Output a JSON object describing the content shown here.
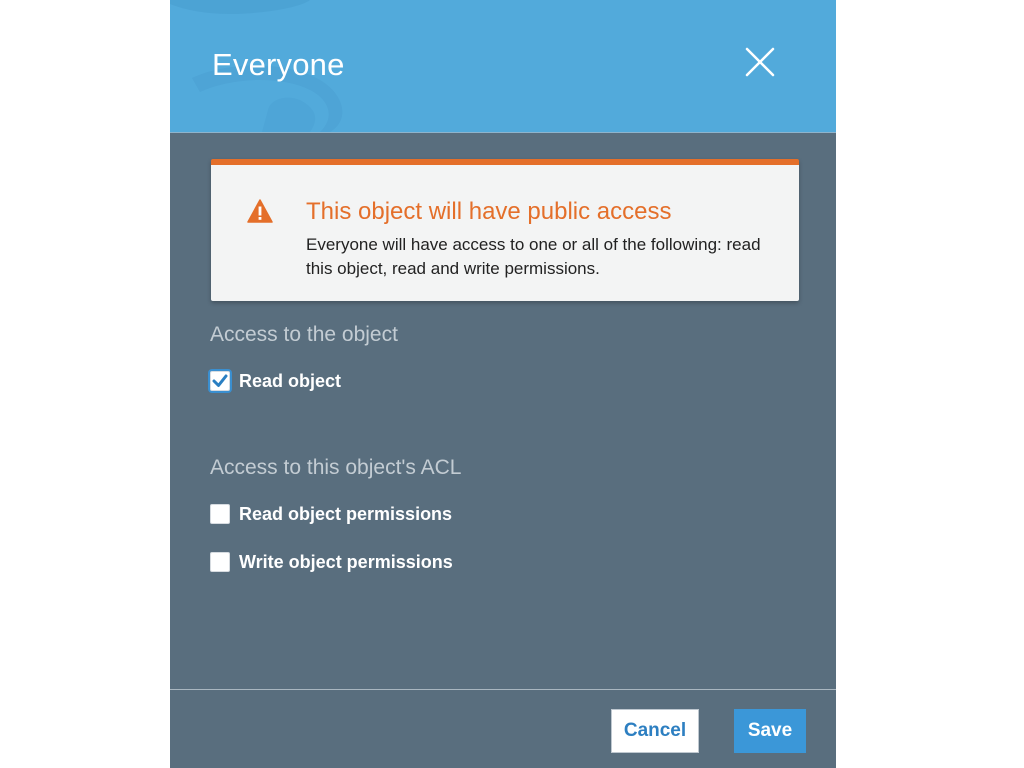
{
  "dialog": {
    "title": "Everyone",
    "close_icon": "close-icon"
  },
  "alert": {
    "icon": "warning-triangle-icon",
    "title": "This object will have public access",
    "message": "Everyone will have access to one or all of the following: read this object, read and write permissions.",
    "accent_color": "#e46f2a"
  },
  "object_access": {
    "heading": "Access to the object",
    "options": [
      {
        "label": "Read object",
        "checked": true
      }
    ]
  },
  "acl_access": {
    "heading": "Access to this object's ACL",
    "options": [
      {
        "label": "Read object permissions",
        "checked": false
      },
      {
        "label": "Write object permissions",
        "checked": false
      }
    ]
  },
  "footer": {
    "cancel_label": "Cancel",
    "save_label": "Save"
  },
  "colors": {
    "header": "#52aadb",
    "panel": "#596e7e",
    "primary_button": "#3b97d8"
  }
}
